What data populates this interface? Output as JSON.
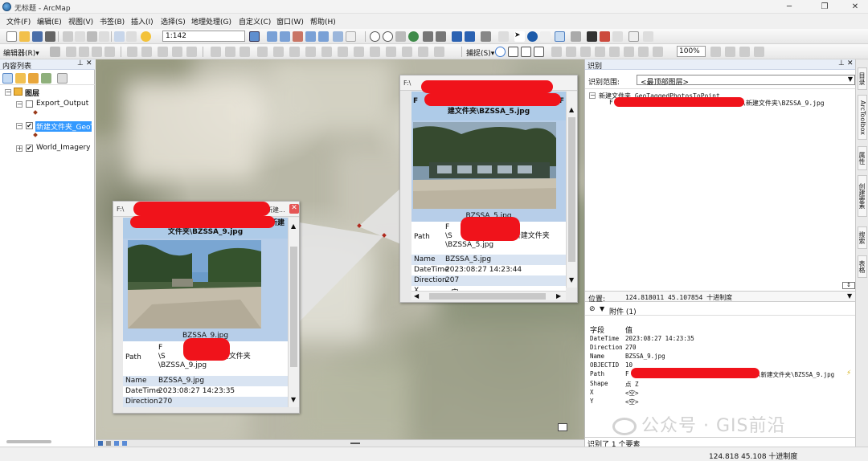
{
  "window": {
    "title": "无标题 - ArcMap"
  },
  "menu": [
    "文件(F)",
    "编辑(E)",
    "视图(V)",
    "书签(B)",
    "插入(I)",
    "选择(S)",
    "地理处理(G)",
    "自定义(C)",
    "窗口(W)",
    "帮助(H)"
  ],
  "toolbar": {
    "scale": "1:142",
    "editor_label": "编辑器(R)▾",
    "snapping_label": "捕捉(S)▾",
    "zoom_pct": "100%"
  },
  "toc": {
    "title": "内容列表",
    "root": "图层",
    "layers": [
      {
        "name": "Export_Output",
        "checked": false,
        "expanded": true
      },
      {
        "name": "新建文件夹_GeoTagged",
        "checked": true,
        "expanded": true,
        "selected": true
      },
      {
        "name": "World_Imagery",
        "checked": true,
        "expanded": false
      }
    ]
  },
  "popup_left": {
    "title_prefix": "F:\\",
    "title_suffix": "新建...",
    "heading_line1": "新建",
    "heading_line2": "文件夹\\BZSSA_9.jpg",
    "caption": "BZSSA_9.jpg",
    "path_label": "Path",
    "path_value_line1": "F",
    "path_value_line2": "\\S",
    "path_value_line2_suffix": "\\新建文件夹",
    "path_value_line3": "\\BZSSA_9.jpg",
    "rows": [
      {
        "k": "Name",
        "v": "BZSSA_9.jpg"
      },
      {
        "k": "DateTime",
        "v": "2023:08:27 14:23:35"
      },
      {
        "k": "Direction",
        "v": "270"
      }
    ]
  },
  "popup_right": {
    "title_prefix": "F:\\",
    "heading_line1": "F",
    "heading_line1_suffix": "F",
    "heading_line2": "建文件夹\\BZSSA_5.jpg",
    "caption": "BZSSA_5.jpg",
    "path_label": "Path",
    "path_value_line1": "F",
    "path_value_line2": "\\S",
    "path_value_line2_suffix": "新建文件夹",
    "path_value_line3": "\\BZSSA_5.jpg",
    "rows": [
      {
        "k": "Name",
        "v": "BZSSA_5.jpg"
      },
      {
        "k": "DateTime",
        "v": "2023:08:27 14:23:44"
      },
      {
        "k": "Direction",
        "v": "207"
      },
      {
        "k": "X",
        "v": "<空>"
      }
    ]
  },
  "identify": {
    "title": "识别",
    "range_label": "识别范围:",
    "range_value": "<最顶部图层>",
    "tree_root": "新建文件夹_GeoTaggedPhotosToPoint",
    "tree_child_prefix": "F",
    "tree_child_suffix": "\\新建文件夹\\BZSSA_9.jpg",
    "location_label": "位置:",
    "location_value": "124.818011  45.107854 十进制度",
    "attachments_label": "附件 (1)",
    "field_header": "字段",
    "value_header": "值",
    "fields": [
      {
        "k": "DateTime",
        "v": "2023:08:27 14:23:35"
      },
      {
        "k": "Direction",
        "v": "270"
      },
      {
        "k": "Name",
        "v": "BZSSA_9.jpg"
      },
      {
        "k": "OBJECTID",
        "v": "10"
      },
      {
        "k": "Path",
        "v": "F",
        "v_suffix": "\\新建文件夹\\BZSSA_9.jpg"
      },
      {
        "k": "Shape",
        "v": "点 Z"
      },
      {
        "k": "X",
        "v": "<空>"
      },
      {
        "k": "Y",
        "v": "<空>"
      }
    ],
    "footer": "识别了 1 个要素"
  },
  "side_tabs": [
    "目录",
    "ArcToolbox",
    "属性",
    "创建要素",
    "搜索",
    "表格"
  ],
  "status": {
    "coords": "124.818  45.108 十进制度"
  },
  "watermark": "公众号 · GIS前沿",
  "colors": {
    "selection": "#3399ff",
    "redaction": "#f0131b",
    "popup_header": "#aecbe8"
  }
}
